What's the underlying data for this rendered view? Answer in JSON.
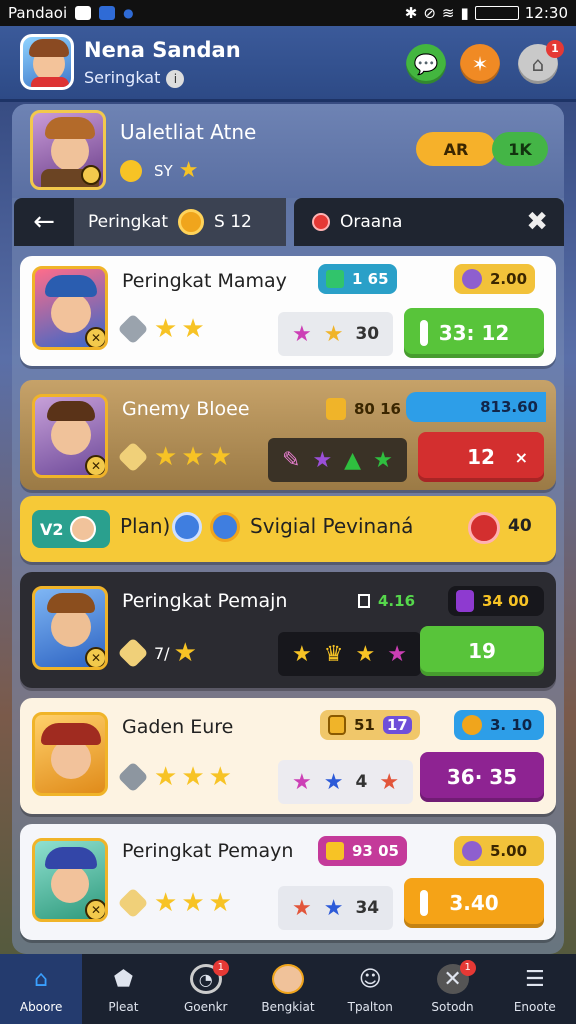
{
  "status_bar": {
    "carrier": "Pandaoi",
    "time": "12:30"
  },
  "header": {
    "name": "Nena Sandan",
    "subtitle": "Seringkat",
    "info_glyph": "i",
    "buttons": [
      {
        "icon": "chat-icon",
        "color": "#43b63f"
      },
      {
        "icon": "star-icon",
        "color": "#f08a24"
      },
      {
        "icon": "shop-icon",
        "color": "#c9c9c9",
        "badge": "1"
      }
    ]
  },
  "profile": {
    "title": "Ualetliat Atne",
    "coins": "SY",
    "pill_left": "AR",
    "pill_right": "1K"
  },
  "tabs": {
    "active_label": "Peringkat",
    "active_count": "S 12",
    "other_label": "Oraana"
  },
  "cards": [
    {
      "name": "Peringkat Mamay",
      "stat1": "1 65",
      "stat2": "2.00",
      "star_count": "30",
      "action": "33: 12",
      "action_color": "#58c43a"
    },
    {
      "name": "Gnemy Bloee",
      "stat1": "80 16",
      "stat2": "813.60",
      "action": "12",
      "action_close": "×",
      "action_color": "#d32f2f"
    },
    {
      "name": "Peringkat Pemajn",
      "coin": "7/",
      "stat1": "4.16",
      "stat2": "34 00",
      "action": "19",
      "action_color": "#58c43a"
    },
    {
      "name": "Gaden Eure",
      "stat1": "51",
      "stat1b": "17",
      "stat2": "3. 10",
      "star_count": "4",
      "action": "36· 35",
      "action_color": "#8e2392"
    },
    {
      "name": "Peringkat Pemayn",
      "stat1": "93 05",
      "stat2": "5.00",
      "star_count": "34",
      "action": "3.40",
      "action_color": "#f5a317"
    }
  ],
  "banner": {
    "badge": "V2",
    "label1": "Plan)",
    "label2": "Svigial Pevinaná",
    "right": "40"
  },
  "bottom_nav": [
    {
      "label": "Aboore",
      "icon": "home-icon",
      "active": true
    },
    {
      "label": "Pleat",
      "icon": "shield-icon"
    },
    {
      "label": "Goenkr",
      "icon": "clock-icon",
      "badge": "1"
    },
    {
      "label": "Bengkiat",
      "icon": "avatar-icon"
    },
    {
      "label": "Tpalton",
      "icon": "chat-icon"
    },
    {
      "label": "Sotodn",
      "icon": "x-icon",
      "badge": "1"
    },
    {
      "label": "Enoote",
      "icon": "menu-icon"
    }
  ]
}
